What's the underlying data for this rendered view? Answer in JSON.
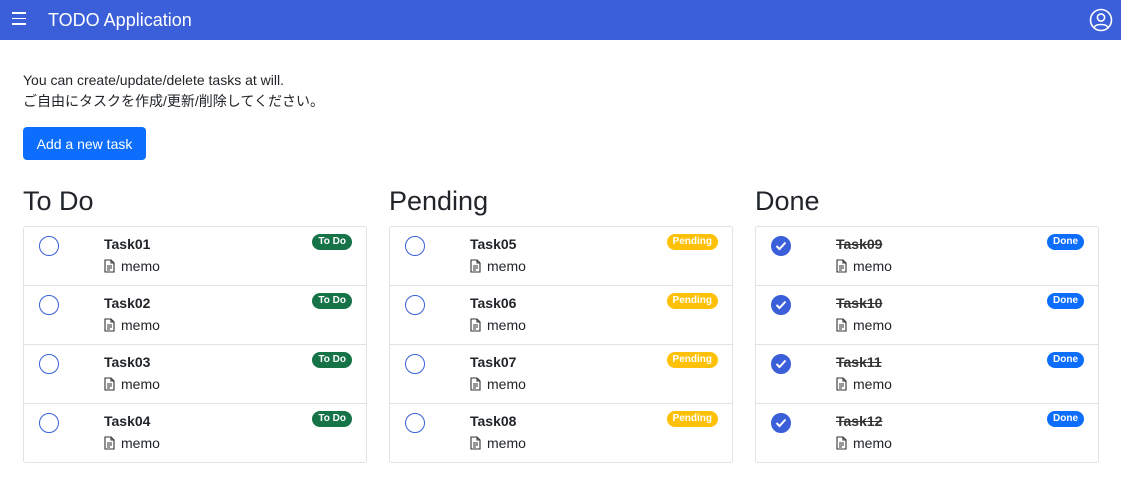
{
  "header": {
    "title": "TODO Application",
    "menu_icon": "menu-icon",
    "account_icon": "account-circle-icon"
  },
  "intro": {
    "line1": "You can create/update/delete tasks at will.",
    "line2": "ご自由にタスクを作成/更新/削除してください。"
  },
  "add_button": "Add a new task",
  "columns": {
    "todo": {
      "title": "To Do",
      "badge_color": "#157347",
      "tasks": [
        {
          "name": "Task01",
          "memo": "memo",
          "status": "To Do",
          "checked": false
        },
        {
          "name": "Task02",
          "memo": "memo",
          "status": "To Do",
          "checked": false
        },
        {
          "name": "Task03",
          "memo": "memo",
          "status": "To Do",
          "checked": false
        },
        {
          "name": "Task04",
          "memo": "memo",
          "status": "To Do",
          "checked": false
        }
      ]
    },
    "pending": {
      "title": "Pending",
      "badge_color": "#ffc107",
      "tasks": [
        {
          "name": "Task05",
          "memo": "memo",
          "status": "Pending",
          "checked": false
        },
        {
          "name": "Task06",
          "memo": "memo",
          "status": "Pending",
          "checked": false
        },
        {
          "name": "Task07",
          "memo": "memo",
          "status": "Pending",
          "checked": false
        },
        {
          "name": "Task08",
          "memo": "memo",
          "status": "Pending",
          "checked": false
        }
      ]
    },
    "done": {
      "title": "Done",
      "badge_color": "#0d6efd",
      "tasks": [
        {
          "name": "Task09",
          "memo": "memo",
          "status": "Done",
          "checked": true
        },
        {
          "name": "Task10",
          "memo": "memo",
          "status": "Done",
          "checked": true
        },
        {
          "name": "Task11",
          "memo": "memo",
          "status": "Done",
          "checked": true
        },
        {
          "name": "Task12",
          "memo": "memo",
          "status": "Done",
          "checked": true
        }
      ]
    }
  },
  "colors": {
    "navbar": "#3a5fd9",
    "primary": "#0d6efd"
  }
}
